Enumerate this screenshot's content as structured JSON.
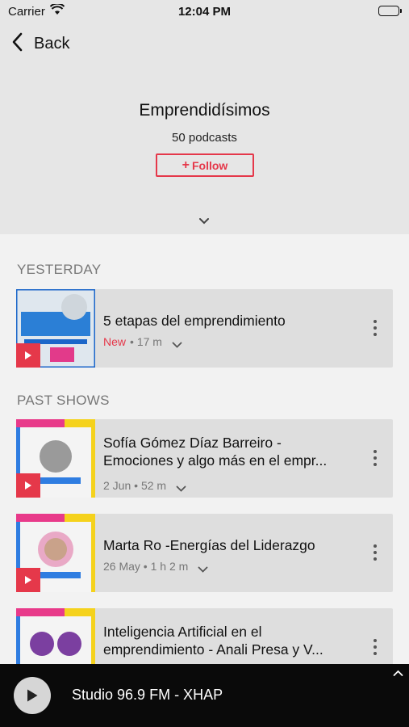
{
  "status_bar": {
    "carrier": "Carrier",
    "time": "12:04 PM"
  },
  "header": {
    "back_label": "Back",
    "title": "Emprendidísimos",
    "podcast_count": "50 podcasts",
    "follow_label": "Follow"
  },
  "sections": {
    "yesterday": "YESTERDAY",
    "past_shows": "PAST SHOWS"
  },
  "episodes": [
    {
      "title": "5 etapas del emprendimiento",
      "badge": "New",
      "date": "",
      "duration": "17 m"
    },
    {
      "title": "Sofía Gómez Díaz Barreiro - Emociones y algo más en el empr...",
      "badge": "",
      "date": "2 Jun",
      "duration": "52 m"
    },
    {
      "title": "Marta Ro -Energías del Liderazgo",
      "badge": "",
      "date": "26 May",
      "duration": "1 h 2 m"
    },
    {
      "title": "Inteligencia Artificial en el emprendimiento - Anali Presa y V...",
      "badge": "",
      "date": "",
      "duration": ""
    }
  ],
  "player": {
    "station": "Studio 96.9 FM - XHAP"
  },
  "colors": {
    "accent": "#e5384a",
    "header_bg": "#e6e6e6",
    "card_bg": "#dedede",
    "player_bg": "#0a0a0a"
  }
}
